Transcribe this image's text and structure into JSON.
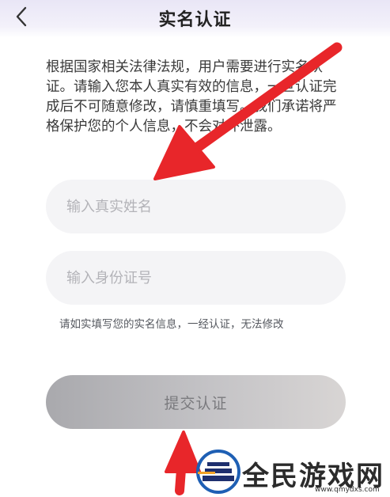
{
  "header": {
    "title": "实名认证",
    "back_icon": "chevron-left-icon"
  },
  "notice": {
    "text": "根据国家相关法律法规，用户需要进行实名认证。请输入您本人真实有效的信息，一旦认证完成后不可随意修改，请慎重填写。我们承诺将严格保护您的个人信息，不会对外泄露。"
  },
  "form": {
    "name_placeholder": "输入真实姓名",
    "name_value": "",
    "id_placeholder": "输入身份证号",
    "id_value": "",
    "hint": "请如实填写您的实名信息，一经认证，无法修改",
    "submit_label": "提交认证"
  },
  "watermark": {
    "text": "全民游戏网",
    "url": "www.qmydxs.com"
  },
  "colors": {
    "arrow": "#e8262a",
    "header_bg": "#ece9f7",
    "field_bg": "#f4f4f6"
  }
}
